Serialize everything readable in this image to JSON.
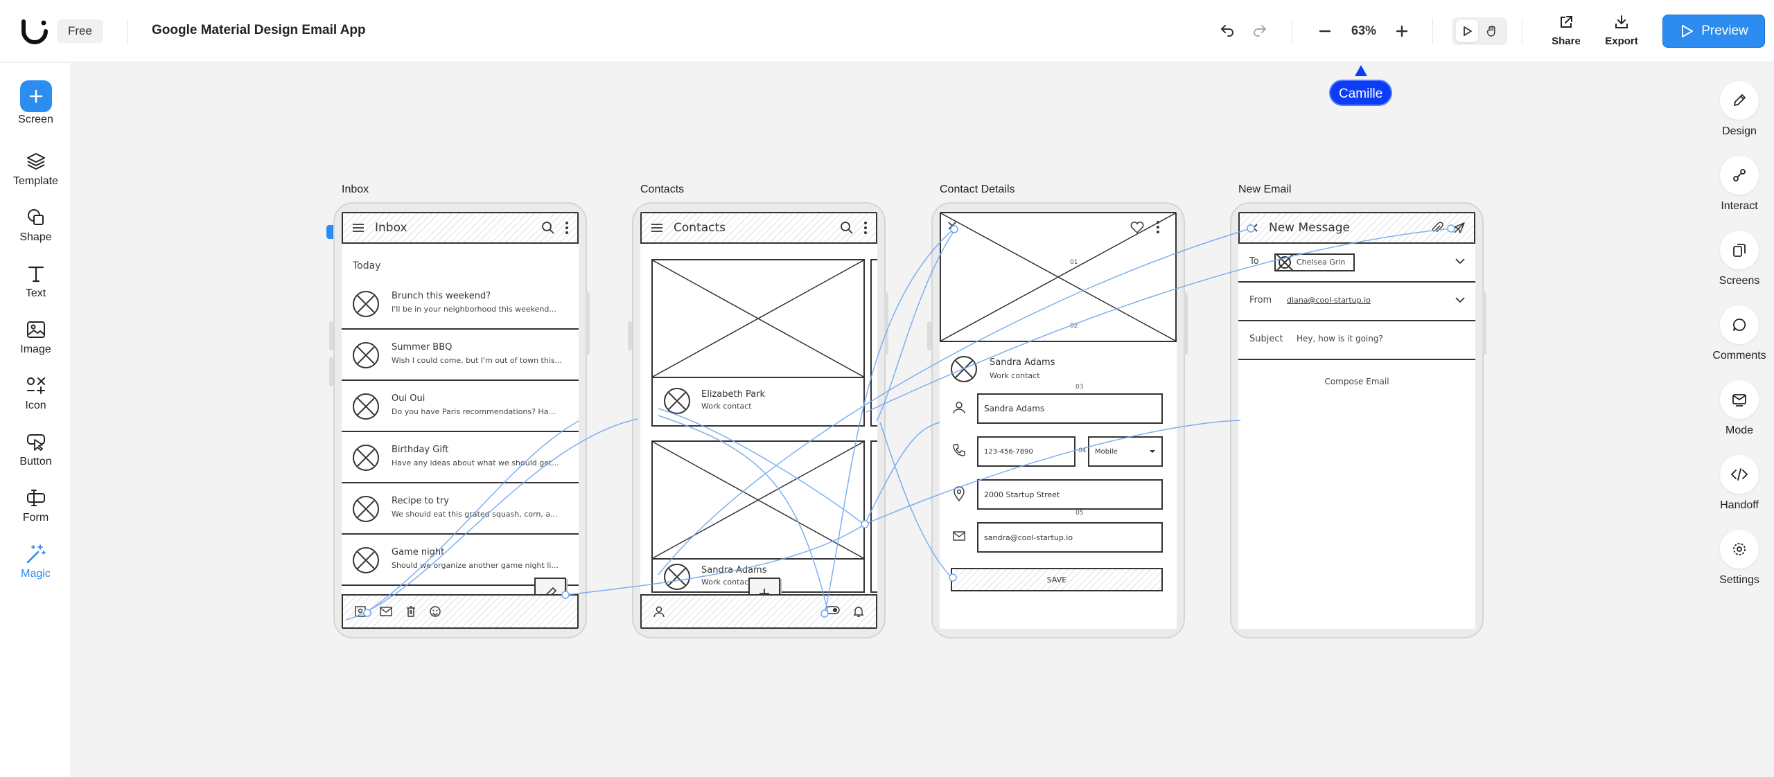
{
  "app": {
    "plan": "Free",
    "project_title": "Google Material Design Email App",
    "zoom": "63%",
    "share_label": "Share",
    "export_label": "Export",
    "preview_label": "Preview",
    "brand_color": "#2d8cf0"
  },
  "collaborator": {
    "name": "Camille",
    "color": "#0b3df5"
  },
  "left_toolbar": [
    {
      "label": "Screen",
      "icon": "plus-icon"
    },
    {
      "label": "Template",
      "icon": "layers-icon"
    },
    {
      "label": "Shape",
      "icon": "shape-icon"
    },
    {
      "label": "Text",
      "icon": "text-icon"
    },
    {
      "label": "Image",
      "icon": "image-icon"
    },
    {
      "label": "Icon",
      "icon": "icons-icon"
    },
    {
      "label": "Button",
      "icon": "button-icon"
    },
    {
      "label": "Form",
      "icon": "form-icon"
    },
    {
      "label": "Magic",
      "icon": "magic-wand-icon"
    }
  ],
  "right_toolbar": [
    {
      "label": "Design",
      "icon": "pencil-icon"
    },
    {
      "label": "Interact",
      "icon": "interact-icon"
    },
    {
      "label": "Screens",
      "icon": "screens-icon"
    },
    {
      "label": "Comments",
      "icon": "comment-icon"
    },
    {
      "label": "Mode",
      "icon": "mode-icon"
    },
    {
      "label": "Handoff",
      "icon": "code-icon"
    },
    {
      "label": "Settings",
      "icon": "gear-icon"
    }
  ],
  "frames": {
    "inbox": {
      "label": "Inbox",
      "title": "Inbox",
      "section": "Today",
      "emails": [
        {
          "title": "Brunch this weekend?",
          "snippet": "I'll be in your neighborhood this weekend..."
        },
        {
          "title": "Summer BBQ",
          "snippet": "Wish I could come, but I'm out of town this..."
        },
        {
          "title": "Oui Oui",
          "snippet": "Do you have Paris recommendations? Ha..."
        },
        {
          "title": "Birthday Gift",
          "snippet": "Have any ideas about what we should get..."
        },
        {
          "title": "Recipe to try",
          "snippet": "We should eat this grated squash, corn, a..."
        },
        {
          "title": "Game night",
          "snippet": "Should we organize another game night li..."
        }
      ]
    },
    "contacts": {
      "label": "Contacts",
      "title": "Contacts",
      "items": [
        {
          "name": "Elizabeth Park",
          "sub": "Work contact"
        },
        {
          "name": "Sandra Adams",
          "sub": "Work contact"
        }
      ]
    },
    "contact_details": {
      "label": "Contact Details",
      "name": "Sandra Adams",
      "sub": "Work contact",
      "name_field": "Sandra Adams",
      "phone_field": "123-456-7890",
      "phone_type": "Mobile",
      "address_field": "2000 Startup Street",
      "email_field": "sandra@cool-startup.io",
      "save_label": "SAVE",
      "markers": [
        "01",
        "02",
        "03",
        "04",
        "05"
      ]
    },
    "new_email": {
      "label": "New Email",
      "title": "New Message",
      "to_label": "To",
      "to_value": "Chelsea Grin",
      "from_label": "From",
      "from_value": "diana@cool-startup.io",
      "subject_label": "Subject",
      "subject_value": "Hey, how is it going?",
      "compose_placeholder": "Compose Email"
    }
  }
}
